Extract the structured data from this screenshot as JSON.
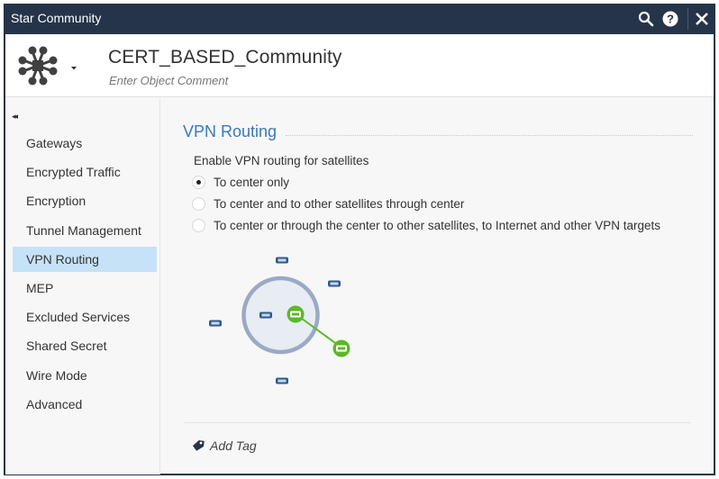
{
  "window": {
    "title": "Star Community",
    "controls": {
      "search": "search-icon",
      "help": "help-icon",
      "close": "close-icon"
    }
  },
  "header": {
    "object_icon": "star-community-icon",
    "object_name": "CERT_BASED_Community",
    "comment_placeholder": "Enter Object Comment"
  },
  "sidebar": {
    "collapse_glyph": "◂◂",
    "items": [
      {
        "label": "Gateways",
        "active": false
      },
      {
        "label": "Encrypted Traffic",
        "active": false
      },
      {
        "label": "Encryption",
        "active": false
      },
      {
        "label": "Tunnel Management",
        "active": false
      },
      {
        "label": "VPN Routing",
        "active": true
      },
      {
        "label": "MEP",
        "active": false
      },
      {
        "label": "Excluded Services",
        "active": false
      },
      {
        "label": "Shared Secret",
        "active": false
      },
      {
        "label": "Wire Mode",
        "active": false
      },
      {
        "label": "Advanced",
        "active": false
      }
    ]
  },
  "main": {
    "section_title": "VPN Routing",
    "group_label": "Enable VPN routing for satellites",
    "options": [
      {
        "label": "To center only",
        "selected": true
      },
      {
        "label": "To center and to other satellites through center",
        "selected": false
      },
      {
        "label": "To center or through the center to other satellites, to Internet and other VPN targets",
        "selected": false
      }
    ],
    "diagram": {
      "description": "Star topology: center gateways inside ring, satellites around; active route from center gateway to one satellite",
      "colors": {
        "ring": "#9aaac4",
        "ring_fill": "#e8ecf3",
        "gateway": "#2f5a8c",
        "active": "#5cb82a"
      }
    },
    "add_tag_label": "Add Tag"
  },
  "colors": {
    "titlebar": "#26344a",
    "accent": "#3a7ab8",
    "nav_active": "#c6e2f7"
  }
}
